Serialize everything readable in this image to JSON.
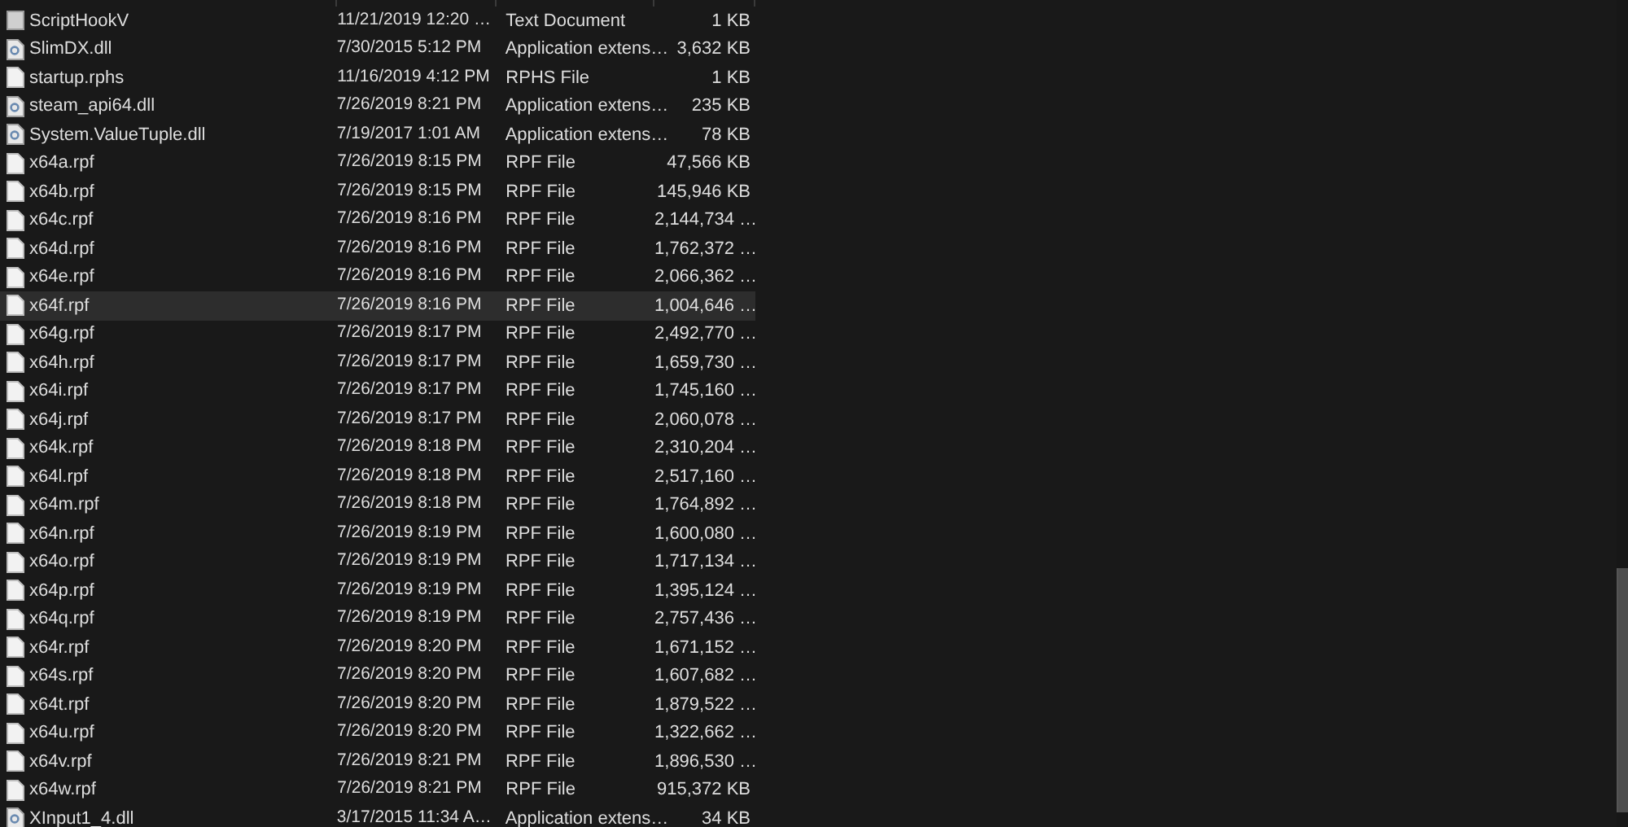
{
  "files": [
    {
      "name": "ScriptHookV",
      "date": "11/21/2019 12:20 …",
      "type": "Text Document",
      "size": "1 KB",
      "kind": "text",
      "selected": false
    },
    {
      "name": "SlimDX.dll",
      "date": "7/30/2015 5:12 PM",
      "type": "Application extens…",
      "size": "3,632 KB",
      "kind": "dll",
      "selected": false
    },
    {
      "name": "startup.rphs",
      "date": "11/16/2019 4:12 PM",
      "type": "RPHS File",
      "size": "1 KB",
      "kind": "file",
      "selected": false
    },
    {
      "name": "steam_api64.dll",
      "date": "7/26/2019 8:21 PM",
      "type": "Application extens…",
      "size": "235 KB",
      "kind": "dll",
      "selected": false
    },
    {
      "name": "System.ValueTuple.dll",
      "date": "7/19/2017 1:01 AM",
      "type": "Application extens…",
      "size": "78 KB",
      "kind": "dll",
      "selected": false
    },
    {
      "name": "x64a.rpf",
      "date": "7/26/2019 8:15 PM",
      "type": "RPF File",
      "size": "47,566 KB",
      "kind": "file",
      "selected": false
    },
    {
      "name": "x64b.rpf",
      "date": "7/26/2019 8:15 PM",
      "type": "RPF File",
      "size": "145,946 KB",
      "kind": "file",
      "selected": false
    },
    {
      "name": "x64c.rpf",
      "date": "7/26/2019 8:16 PM",
      "type": "RPF File",
      "size": "2,144,734 …",
      "kind": "file",
      "selected": false
    },
    {
      "name": "x64d.rpf",
      "date": "7/26/2019 8:16 PM",
      "type": "RPF File",
      "size": "1,762,372 …",
      "kind": "file",
      "selected": false
    },
    {
      "name": "x64e.rpf",
      "date": "7/26/2019 8:16 PM",
      "type": "RPF File",
      "size": "2,066,362 …",
      "kind": "file",
      "selected": false
    },
    {
      "name": "x64f.rpf",
      "date": "7/26/2019 8:16 PM",
      "type": "RPF File",
      "size": "1,004,646 …",
      "kind": "file",
      "selected": true
    },
    {
      "name": "x64g.rpf",
      "date": "7/26/2019 8:17 PM",
      "type": "RPF File",
      "size": "2,492,770 …",
      "kind": "file",
      "selected": false
    },
    {
      "name": "x64h.rpf",
      "date": "7/26/2019 8:17 PM",
      "type": "RPF File",
      "size": "1,659,730 …",
      "kind": "file",
      "selected": false
    },
    {
      "name": "x64i.rpf",
      "date": "7/26/2019 8:17 PM",
      "type": "RPF File",
      "size": "1,745,160 …",
      "kind": "file",
      "selected": false
    },
    {
      "name": "x64j.rpf",
      "date": "7/26/2019 8:17 PM",
      "type": "RPF File",
      "size": "2,060,078 …",
      "kind": "file",
      "selected": false
    },
    {
      "name": "x64k.rpf",
      "date": "7/26/2019 8:18 PM",
      "type": "RPF File",
      "size": "2,310,204 …",
      "kind": "file",
      "selected": false
    },
    {
      "name": "x64l.rpf",
      "date": "7/26/2019 8:18 PM",
      "type": "RPF File",
      "size": "2,517,160 …",
      "kind": "file",
      "selected": false
    },
    {
      "name": "x64m.rpf",
      "date": "7/26/2019 8:18 PM",
      "type": "RPF File",
      "size": "1,764,892 …",
      "kind": "file",
      "selected": false
    },
    {
      "name": "x64n.rpf",
      "date": "7/26/2019 8:19 PM",
      "type": "RPF File",
      "size": "1,600,080 …",
      "kind": "file",
      "selected": false
    },
    {
      "name": "x64o.rpf",
      "date": "7/26/2019 8:19 PM",
      "type": "RPF File",
      "size": "1,717,134 …",
      "kind": "file",
      "selected": false
    },
    {
      "name": "x64p.rpf",
      "date": "7/26/2019 8:19 PM",
      "type": "RPF File",
      "size": "1,395,124 …",
      "kind": "file",
      "selected": false
    },
    {
      "name": "x64q.rpf",
      "date": "7/26/2019 8:19 PM",
      "type": "RPF File",
      "size": "2,757,436 …",
      "kind": "file",
      "selected": false
    },
    {
      "name": "x64r.rpf",
      "date": "7/26/2019 8:20 PM",
      "type": "RPF File",
      "size": "1,671,152 …",
      "kind": "file",
      "selected": false
    },
    {
      "name": "x64s.rpf",
      "date": "7/26/2019 8:20 PM",
      "type": "RPF File",
      "size": "1,607,682 …",
      "kind": "file",
      "selected": false
    },
    {
      "name": "x64t.rpf",
      "date": "7/26/2019 8:20 PM",
      "type": "RPF File",
      "size": "1,879,522 …",
      "kind": "file",
      "selected": false
    },
    {
      "name": "x64u.rpf",
      "date": "7/26/2019 8:20 PM",
      "type": "RPF File",
      "size": "1,322,662 …",
      "kind": "file",
      "selected": false
    },
    {
      "name": "x64v.rpf",
      "date": "7/26/2019 8:21 PM",
      "type": "RPF File",
      "size": "1,896,530 …",
      "kind": "file",
      "selected": false
    },
    {
      "name": "x64w.rpf",
      "date": "7/26/2019 8:21 PM",
      "type": "RPF File",
      "size": "915,372 KB",
      "kind": "file",
      "selected": false
    },
    {
      "name": "XInput1_4.dll",
      "date": "3/17/2015 11:34 A…",
      "type": "Application extens…",
      "size": "34 KB",
      "kind": "dll",
      "selected": false
    }
  ]
}
